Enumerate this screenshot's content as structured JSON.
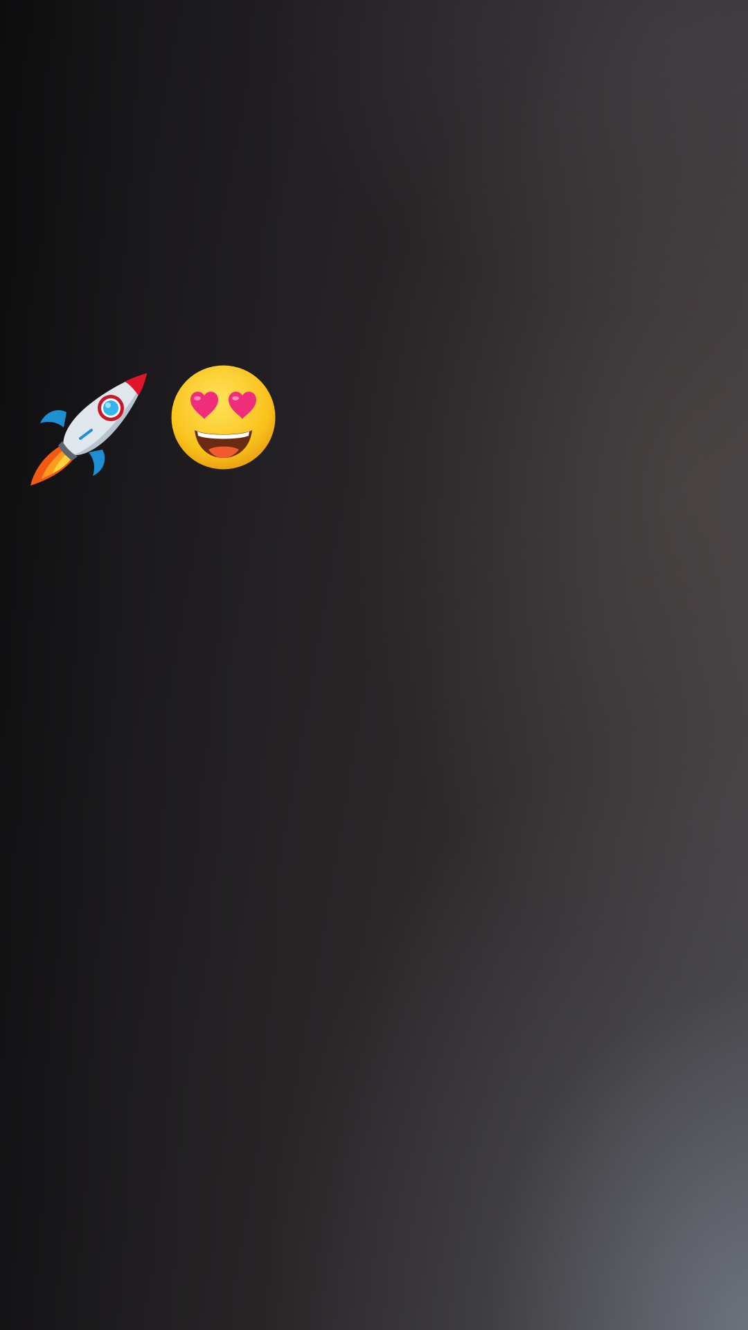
{
  "stickers": [
    {
      "icon": "rocket-icon"
    },
    {
      "icon": "heart-eyes-face-icon"
    }
  ],
  "colors": {
    "background_dark": "#1c1a1c",
    "background_light": "#6a6e74",
    "rocket_body": "#dfe6ec",
    "rocket_nose": "#e0142b",
    "rocket_fin": "#1e8fd2",
    "flame_outer": "#f25a13",
    "flame_inner": "#ffd43a",
    "face_yellow": "#f9c21c",
    "heart_pink": "#ef2d7a",
    "mouth_dark": "#6b2a12"
  }
}
